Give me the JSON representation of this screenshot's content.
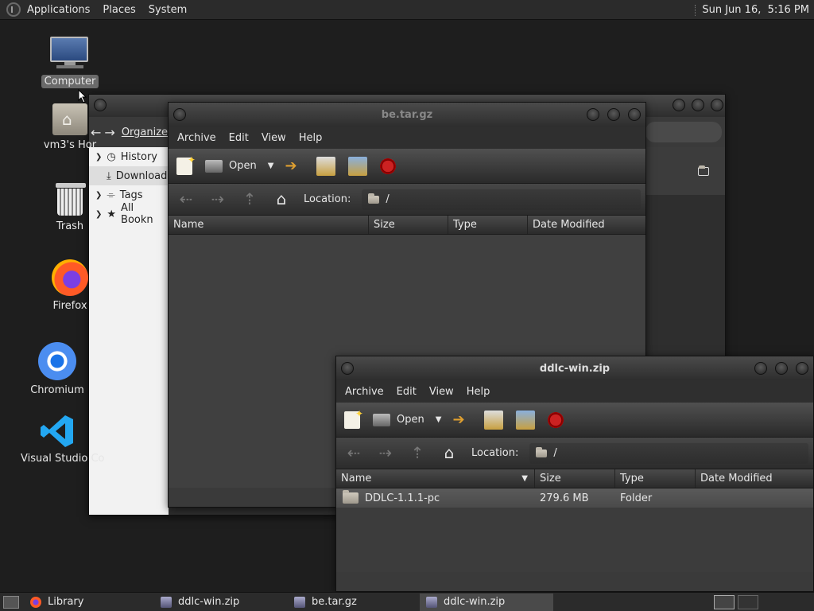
{
  "top_panel": {
    "menus": [
      "Applications",
      "Places",
      "System"
    ],
    "clock": "Sun Jun 16,  5:16 PM"
  },
  "desktop_icons": [
    {
      "label": "Computer",
      "icon": "computer-icon"
    },
    {
      "label": "vm3's Hor",
      "icon": "home-folder-icon"
    },
    {
      "label": "Trash",
      "icon": "trash-icon"
    },
    {
      "label": "Firefox",
      "icon": "firefox-icon"
    },
    {
      "label": "Chromium",
      "icon": "chromium-icon"
    },
    {
      "label": "Visual Studio Co",
      "icon": "vscode-icon"
    }
  ],
  "library_window": {
    "toolbar_label": "Organize",
    "sidebar": [
      {
        "label": "History",
        "icon": "history-icon"
      },
      {
        "label": "Download",
        "icon": "download-icon"
      },
      {
        "label": "Tags",
        "icon": "tag-icon"
      },
      {
        "label": "All Bookn",
        "icon": "star-icon"
      }
    ]
  },
  "be_window": {
    "title": "be.tar.gz",
    "menus": [
      "Archive",
      "Edit",
      "View",
      "Help"
    ],
    "open_label": "Open",
    "location_label": "Location:",
    "location_value": "/",
    "columns": [
      "Name",
      "Size",
      "Type",
      "Date Modified"
    ]
  },
  "ddlc_window": {
    "title": "ddlc-win.zip",
    "menus": [
      "Archive",
      "Edit",
      "View",
      "Help"
    ],
    "open_label": "Open",
    "location_label": "Location:",
    "location_value": "/",
    "columns": [
      "Name",
      "Size",
      "Type",
      "Date Modified"
    ],
    "rows": [
      {
        "name": "DDLC-1.1.1-pc",
        "size": "279.6 MB",
        "type": "Folder",
        "date": ""
      }
    ]
  },
  "taskbar": {
    "items": [
      {
        "label": "Library",
        "icon": "firefox-icon",
        "active": false
      },
      {
        "label": "ddlc-win.zip",
        "icon": "archive-icon",
        "active": false
      },
      {
        "label": "be.tar.gz",
        "icon": "archive-icon",
        "active": false
      },
      {
        "label": "ddlc-win.zip",
        "icon": "archive-icon",
        "active": true
      }
    ]
  },
  "colors": {
    "panel_bg": "#2b2b2b",
    "desktop_bg": "#1e1e1e",
    "window_bg": "#3a3a3a",
    "stop_red": "#c22222"
  }
}
